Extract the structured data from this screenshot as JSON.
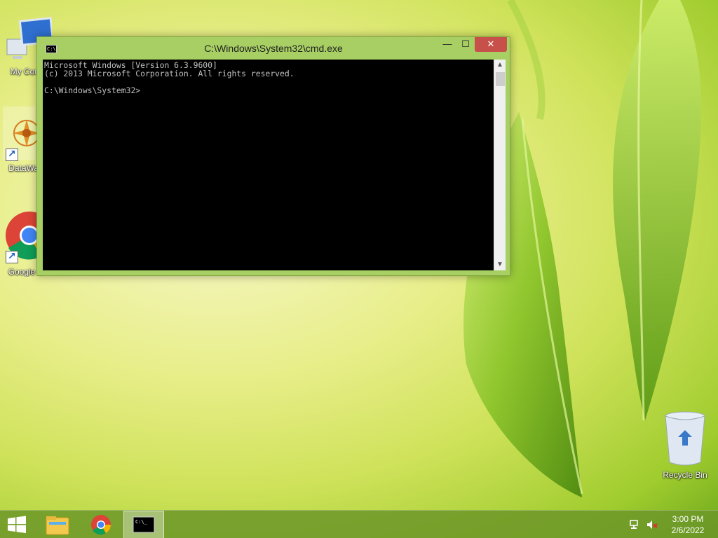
{
  "desktop": {
    "icons": [
      {
        "label": "My Com",
        "icon": "computer-icon"
      },
      {
        "label": "DataWag",
        "icon": "datawagon-icon"
      },
      {
        "label": "Google C",
        "icon": "chrome-icon"
      }
    ],
    "recycle_bin": {
      "label": "Recycle Bin",
      "icon": "recycle-bin-icon"
    }
  },
  "window": {
    "title": "C:\\Windows\\System32\\cmd.exe",
    "controls": {
      "minimize": "—",
      "maximize": "☐",
      "close": "✕"
    },
    "console": {
      "line1": "Microsoft Windows [Version 6.3.9600]",
      "line2": "(c) 2013 Microsoft Corporation. All rights reserved.",
      "prompt": "C:\\Windows\\System32>"
    }
  },
  "taskbar": {
    "items": [
      "start-icon",
      "file-explorer-icon",
      "chrome-icon",
      "cmd-icon"
    ],
    "clock": {
      "time": "3:00 PM",
      "date": "2/6/2022"
    }
  },
  "colors": {
    "titlebar": "#a7cf63",
    "close": "#c7504a",
    "taskbar": "#6c9628"
  }
}
